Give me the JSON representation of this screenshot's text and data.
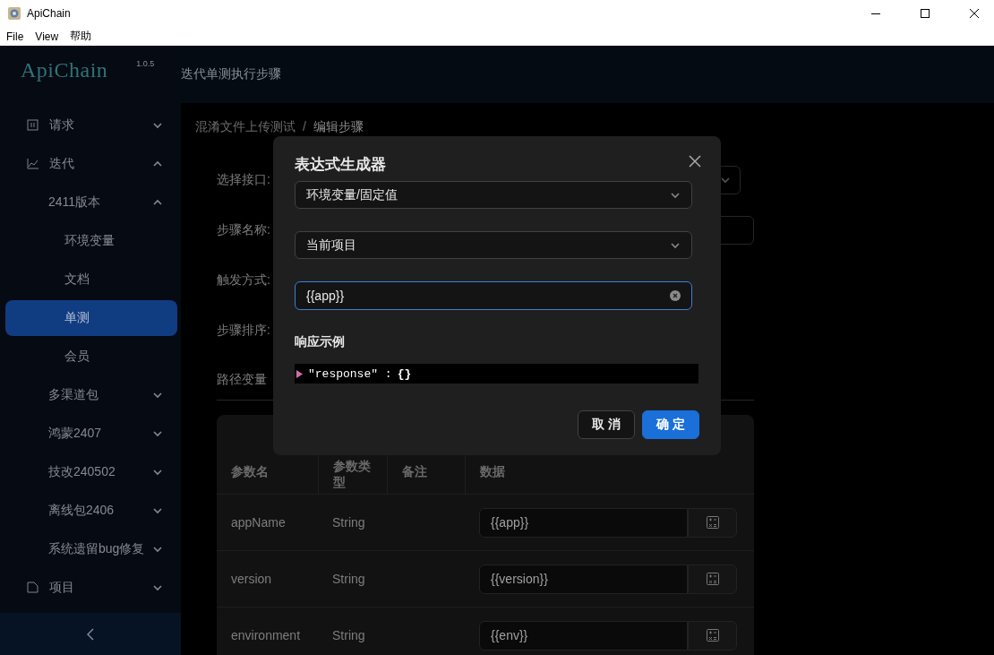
{
  "window": {
    "title": "ApiChain"
  },
  "menu": [
    "File",
    "View",
    "帮助"
  ],
  "sidebar": {
    "logo": "ApiChain",
    "version": "1.0.5",
    "items": [
      {
        "label": "请求",
        "expanded": false,
        "selected": false
      },
      {
        "label": "迭代",
        "expanded": true,
        "selected": false,
        "children": [
          {
            "label": "2411版本",
            "expanded": true,
            "selected": false,
            "children": [
              {
                "label": "环境变量",
                "selected": false
              },
              {
                "label": "文档",
                "selected": false
              },
              {
                "label": "单测",
                "selected": true
              },
              {
                "label": "会员",
                "selected": false
              }
            ]
          },
          {
            "label": "多渠道包",
            "expanded": false,
            "selected": false
          },
          {
            "label": "鸿蒙2407",
            "expanded": false,
            "selected": false
          },
          {
            "label": "技改240502",
            "expanded": false,
            "selected": false
          },
          {
            "label": "离线包2406",
            "expanded": false,
            "selected": false
          },
          {
            "label": "系统遗留bug修复",
            "expanded": false,
            "selected": false
          }
        ]
      },
      {
        "label": "项目",
        "expanded": false,
        "selected": false
      }
    ]
  },
  "header": {
    "title": "迭代单测执行步骤"
  },
  "breadcrumb": {
    "separator": "/",
    "items": [
      "混淆文件上传测试",
      "编辑步骤"
    ]
  },
  "form": [
    {
      "label": "选择接口:",
      "kind": "select"
    },
    {
      "label": "步骤名称:",
      "kind": "input"
    },
    {
      "label": "触发方式:",
      "kind": "hidden"
    },
    {
      "label": "步骤排序:",
      "kind": "hidden"
    }
  ],
  "path_vars": {
    "title": "路径变量",
    "columns": [
      "参数名",
      "参数类型",
      "备注",
      "数据"
    ],
    "rows": [
      {
        "name": "appName",
        "type": "String",
        "value": "{{app}}"
      },
      {
        "name": "version",
        "type": "String",
        "value": "{{version}}"
      },
      {
        "name": "environment",
        "type": "String",
        "value": "{{env}}"
      }
    ]
  },
  "dialog": {
    "title": "表达式生成器",
    "selects": [
      "环境变量/固定值",
      "当前项目"
    ],
    "input": {
      "value": "{{app}}",
      "focused": true
    },
    "example_label": "响应示例",
    "example": {
      "key": "\"response\"",
      "separator": ":",
      "value": "{}"
    },
    "buttons": [
      {
        "label": "取 消",
        "kind": "default"
      },
      {
        "label": "确 定",
        "kind": "primary"
      }
    ]
  }
}
